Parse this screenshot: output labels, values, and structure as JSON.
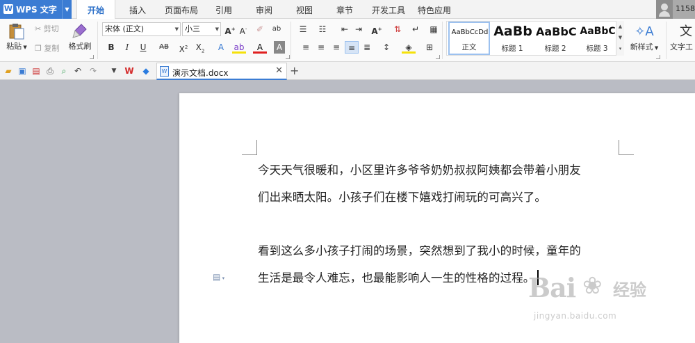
{
  "app": {
    "name": "WPS 文字",
    "logo": "W"
  },
  "menu": {
    "tabs": [
      "开始",
      "插入",
      "页面布局",
      "引用",
      "审阅",
      "视图",
      "章节",
      "开发工具",
      "特色应用"
    ],
    "active": "开始"
  },
  "user": {
    "id": "1158"
  },
  "ribbon": {
    "clipboard": {
      "paste": "粘贴",
      "cut": "剪切",
      "copy": "复制",
      "format_painter": "格式刷"
    },
    "font": {
      "name": "宋体 (正文)",
      "size": "小三"
    },
    "styles": [
      {
        "preview": "AaBbCcDd",
        "label": "正文"
      },
      {
        "preview": "AaBb",
        "label": "标题 1"
      },
      {
        "preview": "AaBbC",
        "label": "标题 2"
      },
      {
        "preview": "AaBbC",
        "label": "标题 3"
      }
    ],
    "new_style": "新样式",
    "text_tools": "文字工"
  },
  "document_tab": {
    "name": "演示文档.docx"
  },
  "document": {
    "paragraphs": [
      [
        "今天天气很暖和，小区里许多爷爷奶奶叔叔阿姨都会带着小朋友",
        "们出来晒太阳。小孩子们在楼下嬉戏打闹玩的可高兴了。"
      ],
      [
        "看到这么多小孩子打闹的场景，突然想到了我小的时候，童年的",
        "生活是最令人难忘，也最能影响人一生的性格的过程。"
      ]
    ]
  },
  "watermark": {
    "brand": "Bai",
    "brand2": "经验",
    "url": "jingyan.baidu.com"
  },
  "colors": {
    "accent": "#3b7cd3",
    "workspace": "#babcc4",
    "page": "#ffffff",
    "font_color_bar": "#e02020",
    "highlight_bar": "#f5e10a"
  }
}
